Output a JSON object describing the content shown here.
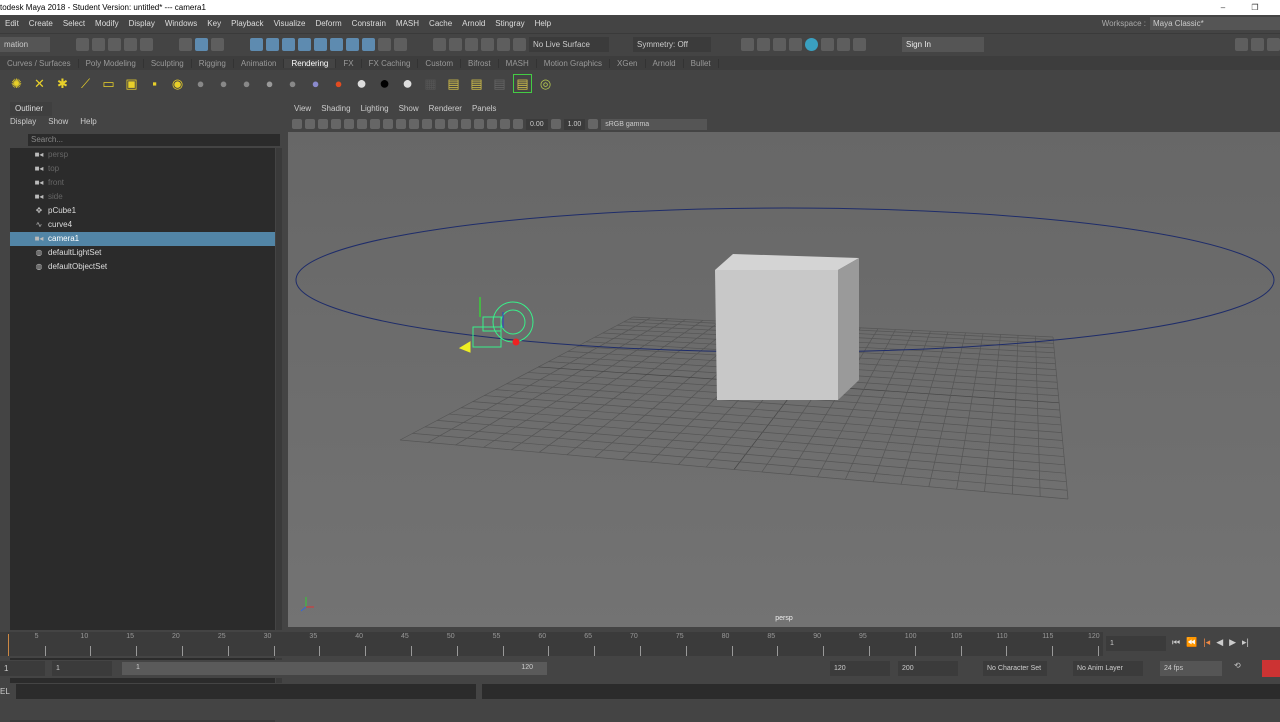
{
  "window": {
    "title": "todesk Maya 2018 - Student Version: untitled*  ---  camera1",
    "minimize": "–",
    "restore": "❐"
  },
  "menubar": [
    "Edit",
    "Create",
    "Select",
    "Modify",
    "Display",
    "Windows",
    "Key",
    "Playback",
    "Visualize",
    "Deform",
    "Constrain",
    "MASH",
    "Cache",
    "Arnold",
    "Stingray",
    "Help"
  ],
  "workspace": {
    "label": "Workspace :",
    "value": "Maya Classic*"
  },
  "status": {
    "menuset": "mation",
    "live_surface": "No Live Surface",
    "symmetry": "Symmetry: Off",
    "sign_in": "Sign In"
  },
  "shelf_tabs": [
    "Curves / Surfaces",
    "Poly Modeling",
    "Sculpting",
    "Rigging",
    "Animation",
    "Rendering",
    "FX",
    "FX Caching",
    "Custom",
    "Bifrost",
    "MASH",
    "Motion Graphics",
    "XGen",
    "Arnold",
    "Bullet"
  ],
  "shelf_active": "Rendering",
  "outliner": {
    "tab": "Outliner",
    "menu": [
      "Display",
      "Show",
      "Help"
    ],
    "search_placeholder": "Search...",
    "items": [
      {
        "name": "persp",
        "icon": "camera",
        "dim": true
      },
      {
        "name": "top",
        "icon": "camera",
        "dim": true
      },
      {
        "name": "front",
        "icon": "camera",
        "dim": true
      },
      {
        "name": "side",
        "icon": "camera",
        "dim": true
      },
      {
        "name": "pCube1",
        "icon": "transform"
      },
      {
        "name": "curve4",
        "icon": "curve"
      },
      {
        "name": "camera1",
        "icon": "camera",
        "selected": true
      },
      {
        "name": "defaultLightSet",
        "icon": "set"
      },
      {
        "name": "defaultObjectSet",
        "icon": "set"
      }
    ]
  },
  "viewport": {
    "menu": [
      "View",
      "Shading",
      "Lighting",
      "Show",
      "Renderer",
      "Panels"
    ],
    "exposure": "0.00",
    "gamma": "1.00",
    "color_space": "sRGB gamma",
    "camera_label": "persp"
  },
  "timeline": {
    "ticks": [
      "5",
      "10",
      "15",
      "20",
      "25",
      "30",
      "35",
      "40",
      "45",
      "50",
      "55",
      "60",
      "65",
      "70",
      "75",
      "80",
      "85",
      "90",
      "95",
      "100",
      "105",
      "110",
      "115",
      "120"
    ],
    "current_frame": "1"
  },
  "range": {
    "start": "1",
    "inner_start": "1",
    "inner_end": "120",
    "end": "120",
    "max": "200",
    "character_set": "No Character Set",
    "anim_layer": "No Anim Layer",
    "fps": "24 fps"
  },
  "cmd": {
    "label": "EL"
  }
}
